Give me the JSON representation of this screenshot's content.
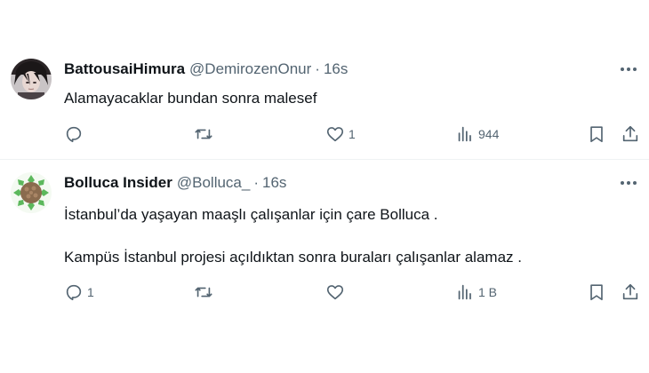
{
  "tweets": [
    {
      "display_name": "BattousaiHimura",
      "handle": "@DemirozenOnur",
      "separator": "·",
      "time": "16s",
      "text": [
        "Alamayacaklar bundan sonra malesef"
      ],
      "replies": "",
      "retweets": "",
      "likes": "1",
      "views": "944"
    },
    {
      "display_name": "Bolluca Insider",
      "handle": "@Bolluca_",
      "separator": "·",
      "time": "16s",
      "text": [
        "İstanbul’da yaşayan maaşlı çalışanlar için çare Bolluca .",
        "Kampüs İstanbul projesi açıldıktan sonra buraları çalışanlar alamaz ."
      ],
      "replies": "1",
      "retweets": "",
      "likes": "",
      "views": "1 B"
    }
  ],
  "icons": {
    "more": "more-horizontal-icon",
    "reply": "reply-bubble-icon",
    "retweet": "retweet-icon",
    "like": "heart-icon",
    "views": "views-bar-chart-icon",
    "bookmark": "bookmark-icon",
    "share": "share-upload-icon"
  },
  "colors": {
    "text": "#0f1419",
    "secondary": "#536471",
    "divider": "#eff3f4",
    "bolluca_avatar_green": "#5cb85c"
  }
}
